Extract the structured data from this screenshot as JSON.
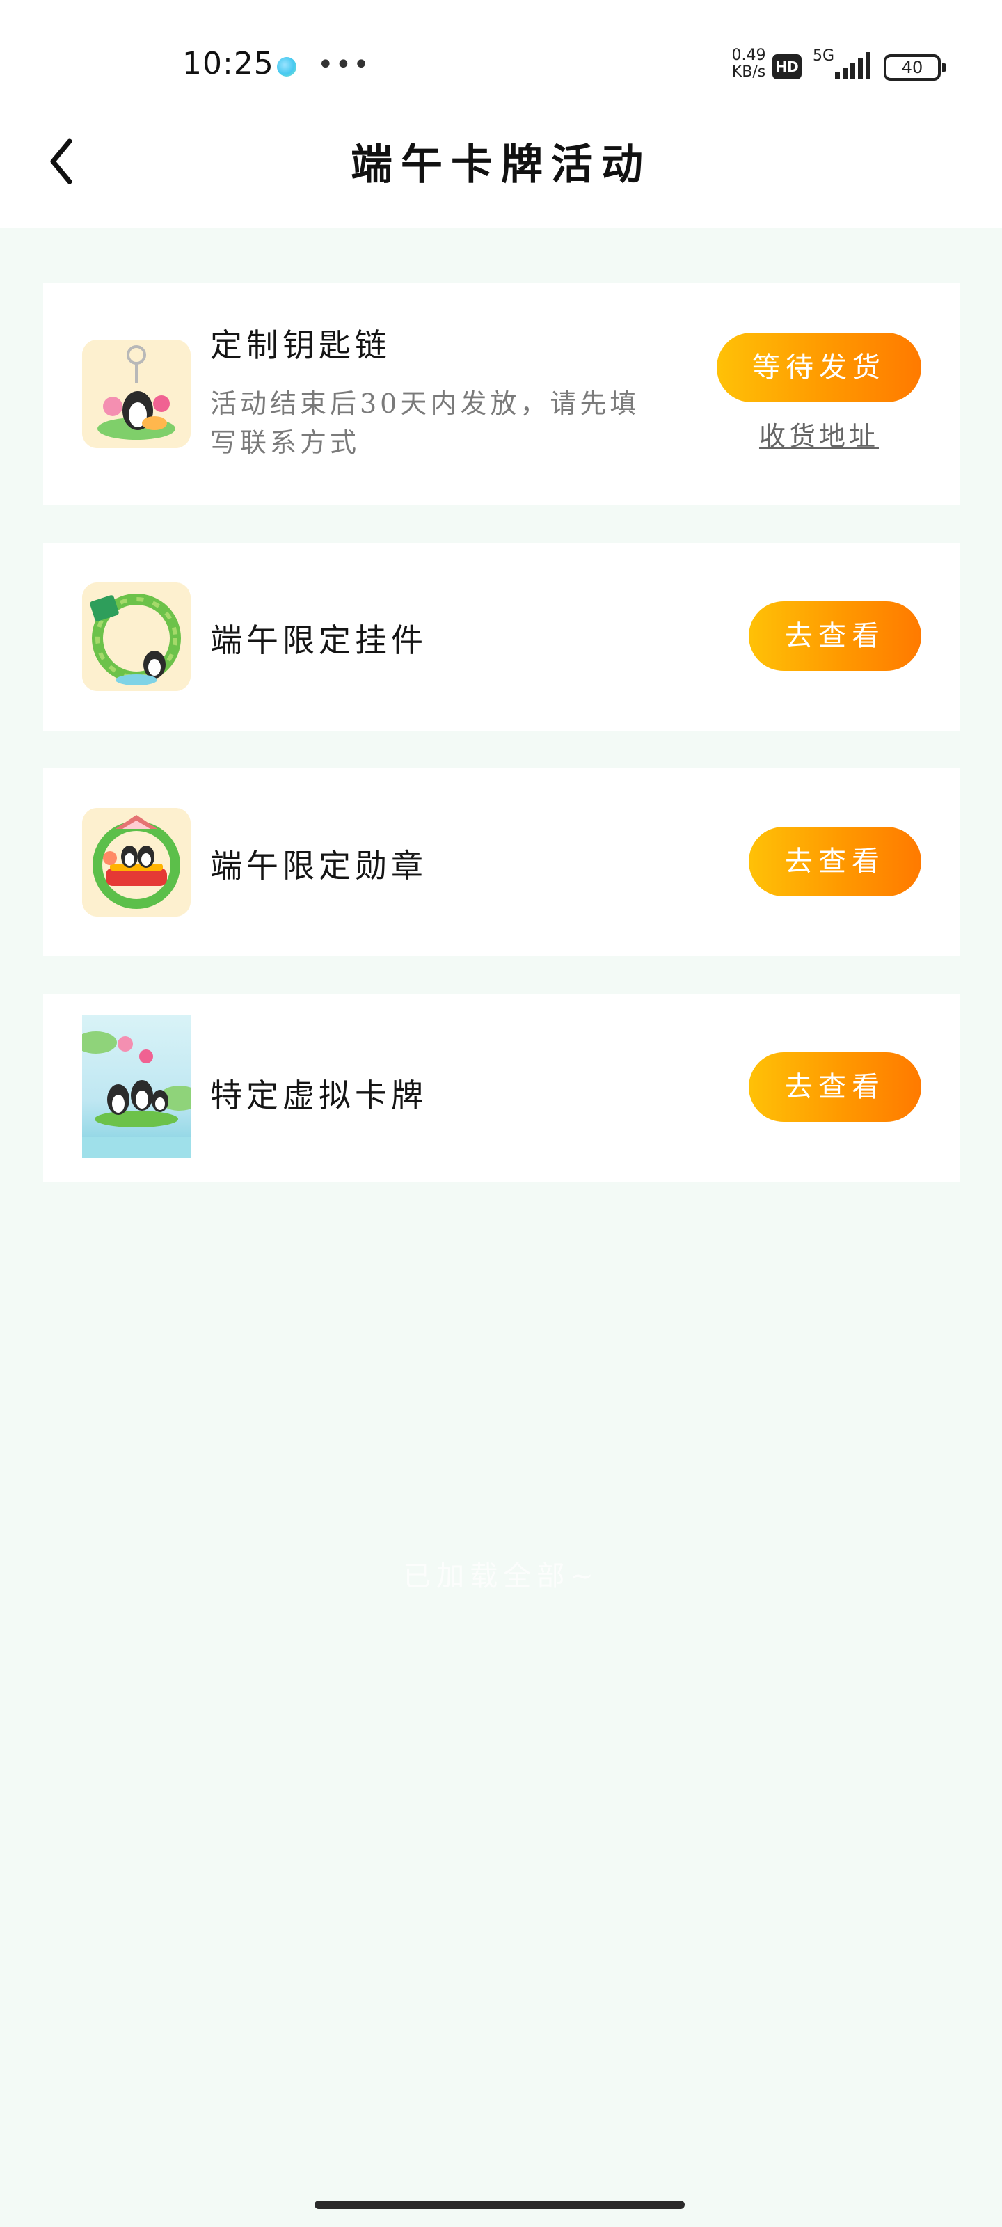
{
  "status_bar": {
    "time": "10:25",
    "more": "•••",
    "net_speed": "0.49",
    "net_unit": "KB/s",
    "hd": "HD",
    "network": "5G",
    "battery": "40"
  },
  "header": {
    "title": "端午卡牌活动",
    "back_icon": "chevron-left-icon"
  },
  "rewards": [
    {
      "title": "定制钥匙链",
      "description": "活动结束后30天内发放，请先填写联系方式",
      "button_label": "等待发货",
      "link_label": "收货地址",
      "thumb": "keychain-image"
    },
    {
      "title": "端午限定挂件",
      "button_label": "去查看",
      "thumb": "pendant-image"
    },
    {
      "title": "端午限定勋章",
      "button_label": "去查看",
      "thumb": "medal-image"
    },
    {
      "title": "特定虚拟卡牌",
      "button_label": "去查看",
      "thumb": "card-image"
    }
  ],
  "footer_note": "已加载全部~",
  "colors": {
    "background": "#f3faf6",
    "button_gradient_start": "#ffc107",
    "button_gradient_end": "#ff7a00"
  }
}
